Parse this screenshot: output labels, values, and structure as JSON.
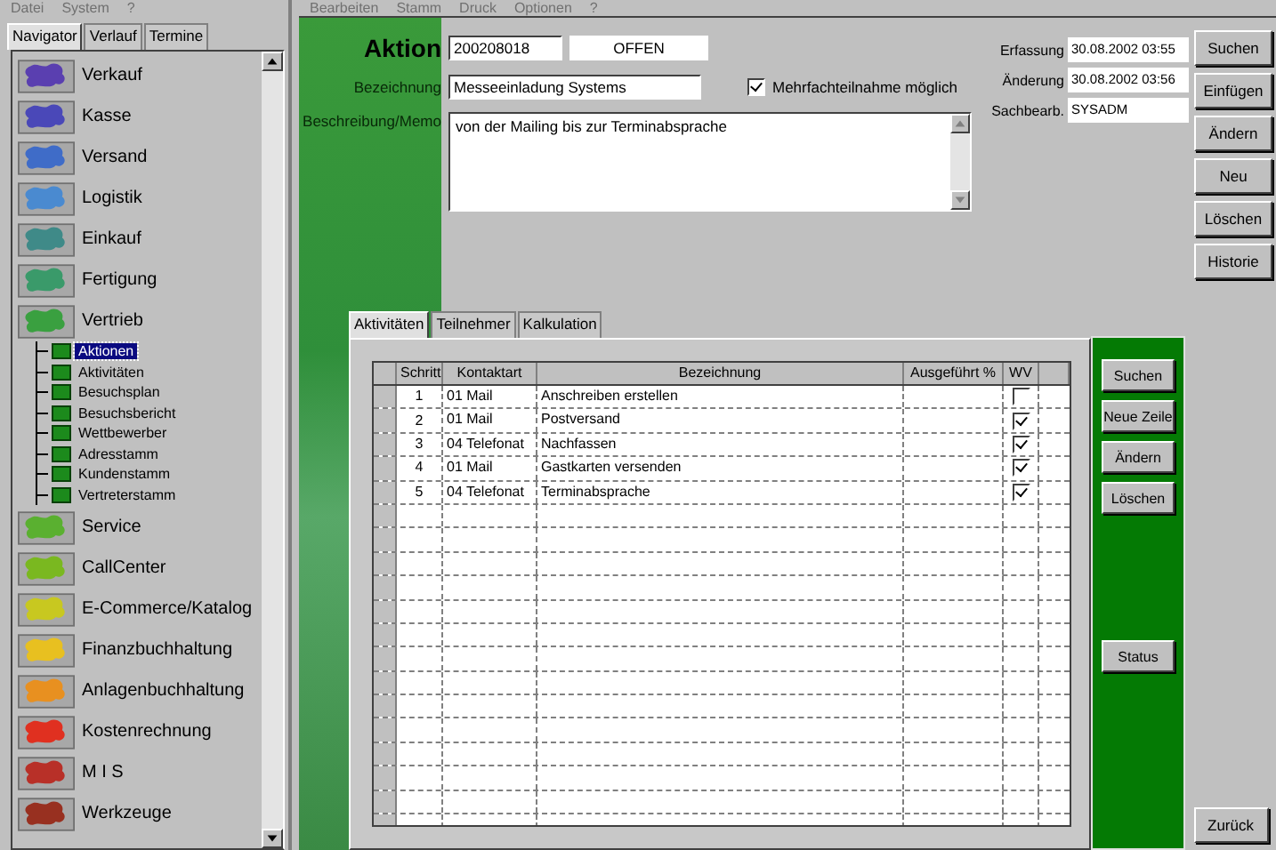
{
  "left_menu": [
    "Datei",
    "System",
    "?"
  ],
  "nav_tabs": [
    {
      "label": "Navigator",
      "selected": true
    },
    {
      "label": "Verlauf",
      "selected": false
    },
    {
      "label": "Termine",
      "selected": false
    }
  ],
  "navigator": [
    {
      "label": "Verkauf",
      "color": "#5a3fb0"
    },
    {
      "label": "Kasse",
      "color": "#4a48b8"
    },
    {
      "label": "Versand",
      "color": "#3f6cc8"
    },
    {
      "label": "Logistik",
      "color": "#4a8ad0"
    },
    {
      "label": "Einkauf",
      "color": "#3f8a88"
    },
    {
      "label": "Fertigung",
      "color": "#3a9a6a"
    },
    {
      "label": "Vertrieb",
      "color": "#3aa040",
      "children": [
        {
          "label": "Aktionen",
          "selected": true
        },
        {
          "label": "Aktivitäten",
          "selected": false
        },
        {
          "label": "Besuchsplan",
          "selected": false
        },
        {
          "label": "Besuchsbericht",
          "selected": false
        },
        {
          "label": "Wettbewerber",
          "selected": false
        },
        {
          "label": "Adresstamm",
          "selected": false
        },
        {
          "label": "Kundenstamm",
          "selected": false
        },
        {
          "label": "Vertreterstamm",
          "selected": false
        }
      ]
    },
    {
      "label": "Service",
      "color": "#5ab030"
    },
    {
      "label": "CallCenter",
      "color": "#7ab820"
    },
    {
      "label": "E-Commerce/Katalog",
      "color": "#c8c820"
    },
    {
      "label": "Finanzbuchhaltung",
      "color": "#e8c020"
    },
    {
      "label": "Anlagenbuchhaltung",
      "color": "#e89020"
    },
    {
      "label": "Kostenrechnung",
      "color": "#e03020"
    },
    {
      "label": "M I S",
      "color": "#b83028"
    },
    {
      "label": "Werkzeuge",
      "color": "#983020"
    }
  ],
  "right_menu": [
    "Bearbeiten",
    "Stamm",
    "Druck",
    "Optionen",
    "?"
  ],
  "form": {
    "title": "Aktion",
    "number": "200208018",
    "status": "OFFEN",
    "name_label": "Bezeichnung",
    "name": "Messeeinladung Systems",
    "multi_checked": true,
    "multi_label": "Mehrfachteilnahme möglich",
    "memo_label": "Beschreibung/Memo",
    "memo": "von der Mailing bis zur Terminabsprache",
    "meta": [
      {
        "label": "Erfassung",
        "value": "30.08.2002 03:55"
      },
      {
        "label": "Änderung",
        "value": "30.08.2002 03:56"
      },
      {
        "label": "Sachbearb.",
        "value": "SYSADM"
      }
    ]
  },
  "buttons": [
    "Suchen",
    "Einfügen",
    "Ändern",
    "Neu",
    "Löschen",
    "Historie"
  ],
  "detail_tabs": [
    {
      "label": "Aktivitäten",
      "selected": true
    },
    {
      "label": "Teilnehmer",
      "selected": false
    },
    {
      "label": "Kalkulation",
      "selected": false
    }
  ],
  "table": {
    "columns": [
      "Schritt",
      "Kontaktart",
      "Bezeichnung",
      "Ausgeführt %",
      "WV"
    ],
    "rows": [
      {
        "step": "1",
        "type": "01  Mail",
        "name": "Anschreiben erstellen",
        "done": "",
        "wv": false
      },
      {
        "step": "2",
        "type": "01  Mail",
        "name": "Postversand",
        "done": "",
        "wv": true
      },
      {
        "step": "3",
        "type": "04  Telefonat",
        "name": "Nachfassen",
        "done": "",
        "wv": true
      },
      {
        "step": "4",
        "type": "01  Mail",
        "name": "Gastkarten versenden",
        "done": "",
        "wv": true
      },
      {
        "step": "5",
        "type": "04  Telefonat",
        "name": "Terminabsprache",
        "done": "",
        "wv": true
      }
    ]
  },
  "table_buttons": [
    "Suchen",
    "Neue Zeile",
    "Ändern",
    "Löschen"
  ],
  "status_button": "Status",
  "back_button": "Zurück"
}
